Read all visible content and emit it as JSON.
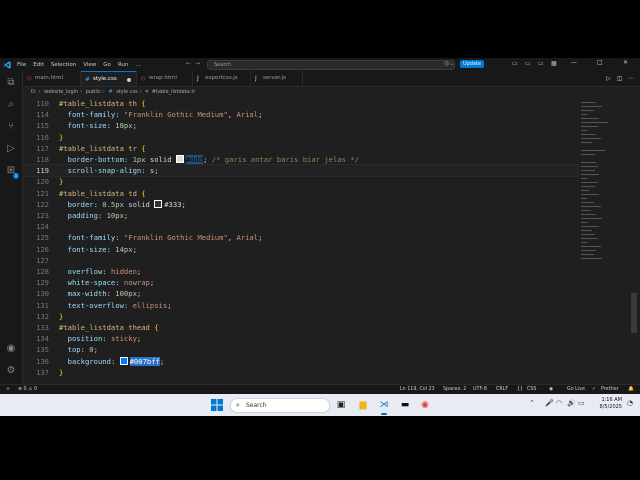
{
  "titlebar": {
    "menu": [
      "File",
      "Edit",
      "Selection",
      "View",
      "Go",
      "Run"
    ],
    "more": "…",
    "search_placeholder": "Search",
    "update_label": "Update"
  },
  "tabs": [
    {
      "label": "main.html",
      "icon": "html-icon",
      "active": false
    },
    {
      "label": "style.css",
      "icon": "css-icon",
      "active": true,
      "modified": true
    },
    {
      "label": "wrap.html",
      "icon": "html-icon",
      "active": false
    },
    {
      "label": "exportcsv.js",
      "icon": "js-icon",
      "active": false
    },
    {
      "label": "server.js",
      "icon": "js-icon",
      "active": false
    }
  ],
  "breadcrumb": [
    "D:",
    "website_login",
    "public",
    "style.css",
    "#table_listdata tr"
  ],
  "editor": {
    "current_line": 119,
    "lines": [
      {
        "n": "110",
        "parts": [
          [
            "sel",
            "#table_listdata th "
          ],
          [
            "brace",
            "{"
          ]
        ]
      },
      {
        "n": "114",
        "parts": [
          [
            "punc",
            "  "
          ],
          [
            "prop",
            "font-family"
          ],
          [
            "punc",
            ": "
          ],
          [
            "str",
            "\"Franklin Gothic Medium\""
          ],
          [
            "punc",
            ", "
          ],
          [
            "str",
            "Arial"
          ],
          [
            "punc",
            ";"
          ]
        ]
      },
      {
        "n": "115",
        "parts": [
          [
            "punc",
            "  "
          ],
          [
            "prop",
            "font-size"
          ],
          [
            "punc",
            ": "
          ],
          [
            "num",
            "18px"
          ],
          [
            "punc",
            ";"
          ]
        ]
      },
      {
        "n": "116",
        "parts": [
          [
            "brace",
            "}"
          ]
        ]
      },
      {
        "n": "117",
        "parts": [
          [
            "sel",
            "#table_listdata tr "
          ],
          [
            "brace",
            "{"
          ]
        ]
      },
      {
        "n": "118",
        "parts": [
          [
            "punc",
            "  "
          ],
          [
            "prop",
            "border-bottom"
          ],
          [
            "punc",
            ": "
          ],
          [
            "num",
            "1px"
          ],
          [
            "punc",
            " solid "
          ],
          [
            "swatch",
            "#dddddd"
          ],
          [
            "hl",
            "#ddd"
          ],
          [
            "punc",
            "; "
          ],
          [
            "comment",
            "/* garis antar baris biar jelas */"
          ]
        ]
      },
      {
        "n": "119",
        "parts": [
          [
            "punc",
            "  "
          ],
          [
            "prop",
            "scroll-snap-align"
          ],
          [
            "punc",
            ": s;"
          ]
        ]
      },
      {
        "n": "120",
        "parts": [
          [
            "brace",
            "}"
          ]
        ]
      },
      {
        "n": "121",
        "parts": [
          [
            "sel",
            "#table_listdata td "
          ],
          [
            "brace",
            "{"
          ]
        ]
      },
      {
        "n": "122",
        "parts": [
          [
            "punc",
            "  "
          ],
          [
            "prop",
            "border"
          ],
          [
            "punc",
            ": "
          ],
          [
            "num",
            "0.5px"
          ],
          [
            "punc",
            " solid "
          ],
          [
            "swatch",
            "#333333"
          ],
          [
            "punc",
            "#333;"
          ]
        ]
      },
      {
        "n": "123",
        "parts": [
          [
            "punc",
            "  "
          ],
          [
            "prop",
            "padding"
          ],
          [
            "punc",
            ": "
          ],
          [
            "num",
            "10px"
          ],
          [
            "punc",
            ";"
          ]
        ]
      },
      {
        "n": "124",
        "parts": []
      },
      {
        "n": "125",
        "parts": [
          [
            "punc",
            "  "
          ],
          [
            "prop",
            "font-family"
          ],
          [
            "punc",
            ": "
          ],
          [
            "str",
            "\"Franklin Gothic Medium\""
          ],
          [
            "punc",
            ", "
          ],
          [
            "str",
            "Arial"
          ],
          [
            "punc",
            ";"
          ]
        ]
      },
      {
        "n": "126",
        "parts": [
          [
            "punc",
            "  "
          ],
          [
            "prop",
            "font-size"
          ],
          [
            "punc",
            ": "
          ],
          [
            "num",
            "14px"
          ],
          [
            "punc",
            ";"
          ]
        ]
      },
      {
        "n": "127",
        "parts": []
      },
      {
        "n": "128",
        "parts": [
          [
            "punc",
            "  "
          ],
          [
            "prop",
            "overflow"
          ],
          [
            "punc",
            ": "
          ],
          [
            "str",
            "hidden"
          ],
          [
            "punc",
            ";"
          ]
        ]
      },
      {
        "n": "129",
        "parts": [
          [
            "punc",
            "  "
          ],
          [
            "prop",
            "white-space"
          ],
          [
            "punc",
            ": "
          ],
          [
            "str",
            "nowrap"
          ],
          [
            "punc",
            ";"
          ]
        ]
      },
      {
        "n": "130",
        "parts": [
          [
            "punc",
            "  "
          ],
          [
            "prop",
            "max-width"
          ],
          [
            "punc",
            ": "
          ],
          [
            "num",
            "100px"
          ],
          [
            "punc",
            ";"
          ]
        ]
      },
      {
        "n": "131",
        "parts": [
          [
            "punc",
            "  "
          ],
          [
            "prop",
            "text-overflow"
          ],
          [
            "punc",
            ": "
          ],
          [
            "str",
            "ellipsis"
          ],
          [
            "punc",
            ";"
          ]
        ]
      },
      {
        "n": "132",
        "parts": [
          [
            "brace",
            "}"
          ]
        ]
      },
      {
        "n": "133",
        "parts": [
          [
            "sel",
            "#table_listdata thead "
          ],
          [
            "brace",
            "{"
          ]
        ]
      },
      {
        "n": "134",
        "parts": [
          [
            "punc",
            "  "
          ],
          [
            "prop",
            "position"
          ],
          [
            "punc",
            ": "
          ],
          [
            "str",
            "sticky"
          ],
          [
            "punc",
            ";"
          ]
        ]
      },
      {
        "n": "135",
        "parts": [
          [
            "punc",
            "  "
          ],
          [
            "prop",
            "top"
          ],
          [
            "punc",
            ": "
          ],
          [
            "num",
            "0"
          ],
          [
            "punc",
            ";"
          ]
        ]
      },
      {
        "n": "136",
        "parts": [
          [
            "punc",
            "  "
          ],
          [
            "prop",
            "background"
          ],
          [
            "punc",
            ": "
          ],
          [
            "swatch",
            "#007bff"
          ],
          [
            "hl2",
            "#007bff"
          ],
          [
            "punc",
            ";"
          ]
        ]
      },
      {
        "n": "137",
        "parts": [
          [
            "brace",
            "}"
          ]
        ]
      }
    ]
  },
  "statusbar": {
    "position": "Ln 119, Col 23",
    "spaces": "Spaces: 2",
    "encoding": "UTF-8",
    "eol": "CRLF",
    "language": "CSS",
    "go_live": "Go Live",
    "prettier": "Prettier"
  },
  "taskbar": {
    "search_label": "Search",
    "time": "1:16 AM",
    "date": "8/5/2025"
  },
  "colors": {
    "accent": "#0078d4",
    "editor_bg": "#1f1f1f"
  }
}
